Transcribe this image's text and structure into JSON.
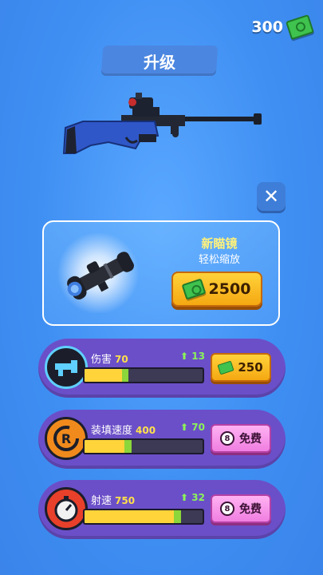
{
  "currency": {
    "amount": "300",
    "icon": "cash-icon"
  },
  "header": {
    "title": "升级"
  },
  "close": {
    "label": "✕"
  },
  "scope_offer": {
    "name": "新瞄镜",
    "description": "轻松缩放",
    "price": "2500"
  },
  "upgrades": [
    {
      "label": "伤害",
      "level": "70",
      "increase": "13",
      "progress": 0.32,
      "next": 0.05,
      "button_type": "cash",
      "button_label": "250",
      "icon": "gun-barrel-icon"
    },
    {
      "label": "装填速度",
      "level": "400",
      "increase": "70",
      "progress": 0.34,
      "next": 0.06,
      "button_type": "free",
      "button_label": "免费",
      "icon": "reload-icon"
    },
    {
      "label": "射速",
      "level": "750",
      "increase": "32",
      "progress": 0.76,
      "next": 0.06,
      "button_type": "free",
      "button_label": "免费",
      "icon": "stopwatch-icon"
    }
  ]
}
